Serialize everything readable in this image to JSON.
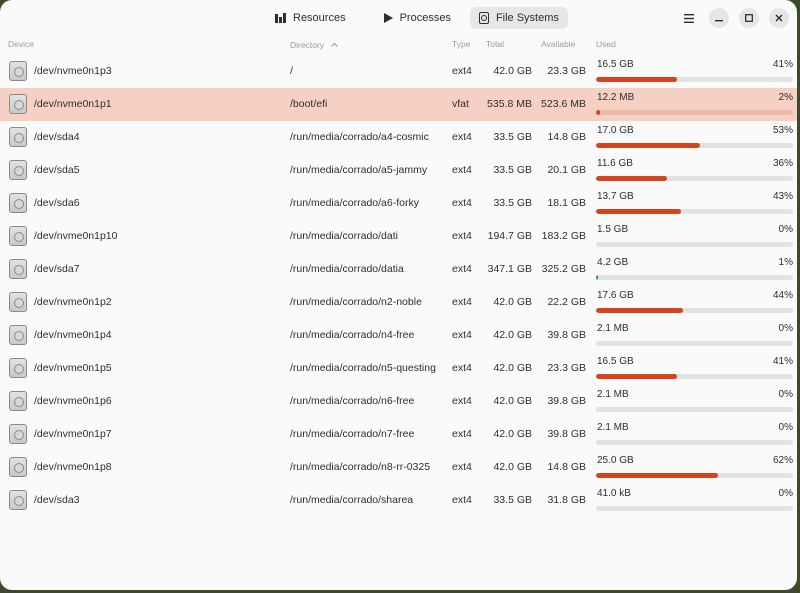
{
  "header": {
    "tabs": [
      {
        "label": "Resources",
        "icon": "bar-chart-icon",
        "active": false
      },
      {
        "label": "Processes",
        "icon": "play-icon",
        "active": false
      },
      {
        "label": "File Systems",
        "icon": "disk-icon",
        "active": true
      }
    ]
  },
  "columns": {
    "device": "Device",
    "directory": "Directory",
    "type": "Type",
    "total": "Total",
    "available": "Available",
    "used": "Used",
    "sorted_by": "directory"
  },
  "colors": {
    "accent": "#d5441c",
    "selection": "#f6d0c3",
    "low_usage": "#2ea04a"
  },
  "rows": [
    {
      "device": "/dev/nvme0n1p3",
      "directory": "/",
      "type": "ext4",
      "total": "42.0 GB",
      "available": "23.3 GB",
      "used": "16.5 GB",
      "percent": "41%",
      "fraction": 0.41
    },
    {
      "device": "/dev/nvme0n1p1",
      "directory": "/boot/efi",
      "type": "vfat",
      "total": "535.8 MB",
      "available": "523.6 MB",
      "used": "12.2 MB",
      "percent": "2%",
      "fraction": 0.02,
      "selected": true
    },
    {
      "device": "/dev/sda4",
      "directory": "/run/media/corrado/a4-cosmic",
      "type": "ext4",
      "total": "33.5 GB",
      "available": "14.8 GB",
      "used": "17.0 GB",
      "percent": "53%",
      "fraction": 0.53
    },
    {
      "device": "/dev/sda5",
      "directory": "/run/media/corrado/a5-jammy",
      "type": "ext4",
      "total": "33.5 GB",
      "available": "20.1 GB",
      "used": "11.6 GB",
      "percent": "36%",
      "fraction": 0.36
    },
    {
      "device": "/dev/sda6",
      "directory": "/run/media/corrado/a6-forky",
      "type": "ext4",
      "total": "33.5 GB",
      "available": "18.1 GB",
      "used": "13.7 GB",
      "percent": "43%",
      "fraction": 0.43
    },
    {
      "device": "/dev/nvme0n1p10",
      "directory": "/run/media/corrado/dati",
      "type": "ext4",
      "total": "194.7 GB",
      "available": "183.2 GB",
      "used": "1.5 GB",
      "percent": "0%",
      "fraction": 0.0
    },
    {
      "device": "/dev/sda7",
      "directory": "/run/media/corrado/datia",
      "type": "ext4",
      "total": "347.1 GB",
      "available": "325.2 GB",
      "used": "4.2 GB",
      "percent": "1%",
      "fraction": 0.01,
      "low": true
    },
    {
      "device": "/dev/nvme0n1p2",
      "directory": "/run/media/corrado/n2-noble",
      "type": "ext4",
      "total": "42.0 GB",
      "available": "22.2 GB",
      "used": "17.6 GB",
      "percent": "44%",
      "fraction": 0.44
    },
    {
      "device": "/dev/nvme0n1p4",
      "directory": "/run/media/corrado/n4-free",
      "type": "ext4",
      "total": "42.0 GB",
      "available": "39.8 GB",
      "used": "2.1 MB",
      "percent": "0%",
      "fraction": 0.0
    },
    {
      "device": "/dev/nvme0n1p5",
      "directory": "/run/media/corrado/n5-questing",
      "type": "ext4",
      "total": "42.0 GB",
      "available": "23.3 GB",
      "used": "16.5 GB",
      "percent": "41%",
      "fraction": 0.41
    },
    {
      "device": "/dev/nvme0n1p6",
      "directory": "/run/media/corrado/n6-free",
      "type": "ext4",
      "total": "42.0 GB",
      "available": "39.8 GB",
      "used": "2.1 MB",
      "percent": "0%",
      "fraction": 0.0
    },
    {
      "device": "/dev/nvme0n1p7",
      "directory": "/run/media/corrado/n7-free",
      "type": "ext4",
      "total": "42.0 GB",
      "available": "39.8 GB",
      "used": "2.1 MB",
      "percent": "0%",
      "fraction": 0.0
    },
    {
      "device": "/dev/nvme0n1p8",
      "directory": "/run/media/corrado/n8-rr-0325",
      "type": "ext4",
      "total": "42.0 GB",
      "available": "14.8 GB",
      "used": "25.0 GB",
      "percent": "62%",
      "fraction": 0.62
    },
    {
      "device": "/dev/sda3",
      "directory": "/run/media/corrado/sharea",
      "type": "ext4",
      "total": "33.5 GB",
      "available": "31.8 GB",
      "used": "41.0 kB",
      "percent": "0%",
      "fraction": 0.0
    }
  ]
}
